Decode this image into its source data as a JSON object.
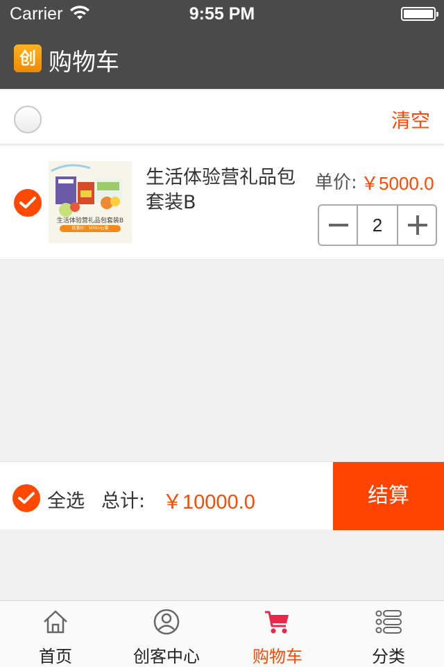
{
  "status_bar": {
    "carrier": "Carrier",
    "time": "9:55 PM"
  },
  "header": {
    "logo_text": "创",
    "title": "购物车"
  },
  "cart_head": {
    "clear_label": "清空"
  },
  "item": {
    "name": "生活体验营礼品包套装B",
    "price_label": "单价:",
    "price_value": "￥5000.0",
    "quantity": "2",
    "image_caption": "生活体验营礼品包套装B",
    "image_sub": "优惠价：5000元/套"
  },
  "summary": {
    "select_all_label": "全选",
    "total_label": "总计:",
    "total_value": "￥10000.0",
    "checkout_label": "结算"
  },
  "tabs": [
    {
      "label": "首页",
      "icon": "home-icon"
    },
    {
      "label": "创客中心",
      "icon": "user-icon"
    },
    {
      "label": "购物车",
      "icon": "cart-icon"
    },
    {
      "label": "分类",
      "icon": "list-icon"
    }
  ],
  "colors": {
    "accent": "#ff4800",
    "header_bg": "#4a4a4a"
  }
}
